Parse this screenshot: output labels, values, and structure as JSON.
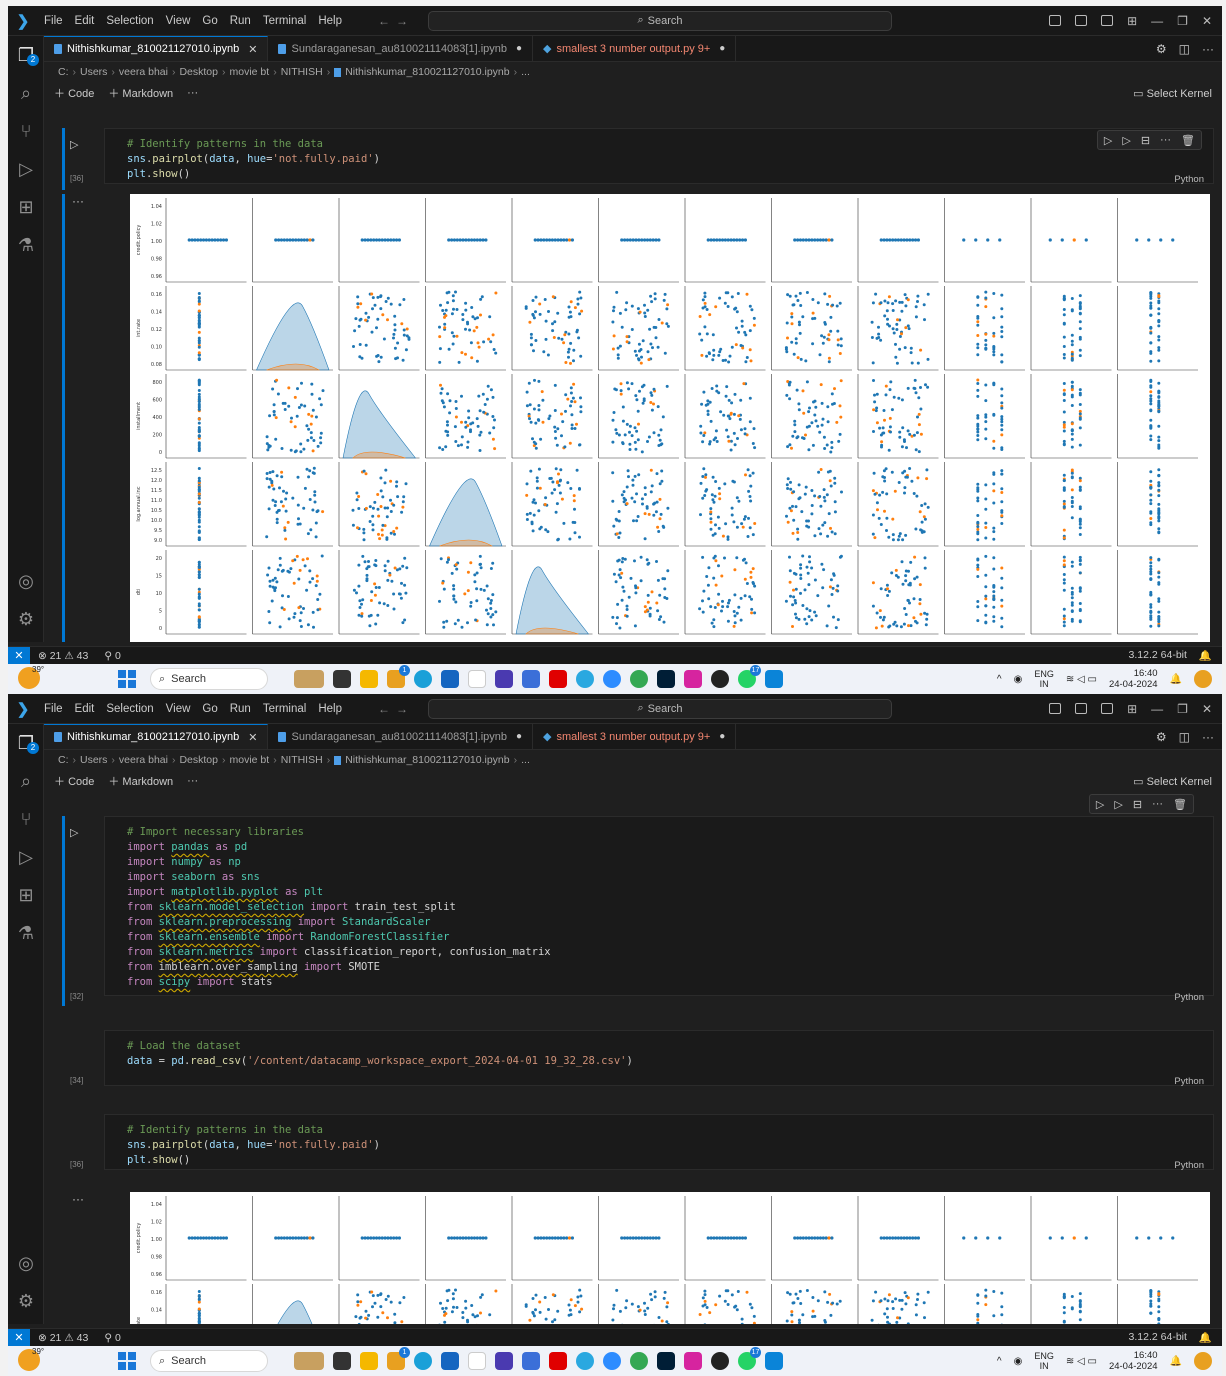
{
  "window": {
    "menu": [
      "File",
      "Edit",
      "Selection",
      "View",
      "Go",
      "Run",
      "Terminal",
      "Help"
    ],
    "search_label": "Search"
  },
  "activity": {
    "explorer_badge": "2"
  },
  "tabs": [
    {
      "label": "Nithishkumar_810021127010.ipynb",
      "state": "active"
    },
    {
      "label": "Sundaraganesan_au810021114083[1].ipynb",
      "state": "modified"
    },
    {
      "label": "smallest 3 number output.py 9+",
      "state": "warning"
    }
  ],
  "breadcrumb": [
    "C:",
    "Users",
    "veera bhai",
    "Desktop",
    "movie bt",
    "NITHISH",
    "Nithishkumar_810021127010.ipynb",
    "..."
  ],
  "toolbar": {
    "code": "Code",
    "markdown": "Markdown",
    "more": "···",
    "kernel": "Select Kernel"
  },
  "cell_language": "Python",
  "cells": {
    "imports": {
      "number": "[32]",
      "lines": [
        "# Import necessary libraries",
        "import pandas as pd",
        "import numpy as np",
        "import seaborn as sns",
        "import matplotlib.pyplot as plt",
        "from sklearn.model_selection import train_test_split",
        "from sklearn.preprocessing import StandardScaler",
        "from sklearn.ensemble import RandomForestClassifier",
        "from sklearn.metrics import classification_report, confusion_matrix",
        "from imblearn.over_sampling import SMOTE",
        "from scipy import stats"
      ]
    },
    "load": {
      "number": "[34]",
      "lines": [
        "# Load the dataset",
        "data = pd.read_csv('/content/datacamp_workspace_export_2024-04-01 19_32_28.csv')"
      ]
    },
    "pairplot": {
      "number": "[36]",
      "lines": [
        "# Identify patterns in the data",
        "sns.pairplot(data, hue='not.fully.paid')",
        "plt.show()"
      ]
    }
  },
  "output_ellipsis": "···",
  "chart_data": {
    "type": "scatter",
    "kind": "pairplot",
    "hue_colors": [
      "#1f77b4",
      "#ff7f0e"
    ],
    "columns": 12,
    "rows": [
      {
        "ylabel": "credit.policy",
        "ticks": [
          "1.04",
          "1.02",
          "1.00",
          "0.98",
          "0.96"
        ],
        "ylim": [
          0.96,
          1.04
        ]
      },
      {
        "ylabel": "int.rate",
        "ticks": [
          "0.16",
          "0.14",
          "0.12",
          "0.10",
          "0.08"
        ],
        "ylim": [
          0.07,
          0.165
        ]
      },
      {
        "ylabel": "installment",
        "ticks": [
          "800",
          "600",
          "400",
          "200",
          "0"
        ],
        "ylim": [
          0,
          850
        ]
      },
      {
        "ylabel": "log.annual.inc",
        "ticks": [
          "12.5",
          "12.0",
          "11.5",
          "11.0",
          "10.5",
          "10.0",
          "9.5",
          "9.0"
        ],
        "ylim": [
          9.0,
          12.6
        ]
      },
      {
        "ylabel": "dti",
        "ticks": [
          "20",
          "15",
          "10",
          "5",
          "0"
        ],
        "ylim": [
          -1,
          23
        ]
      }
    ],
    "diagonal_kde_row": [
      1,
      2,
      3,
      4
    ]
  },
  "status": {
    "errors": "21",
    "warnings": "43",
    "ports": "0",
    "python_version": "3.12.2 64-bit"
  },
  "taskbar": {
    "temperature": "39°",
    "search": "Search",
    "notif_badge_1": "1",
    "notif_badge_2": "17",
    "lang_top": "ENG",
    "lang_bottom": "IN",
    "time": "16:40",
    "date": "24-04-2024"
  },
  "colors": {
    "accent": "#0078d4",
    "editor_bg": "#1f1f1f",
    "comment": "#6a9955",
    "keyword": "#c586c0",
    "module": "#4ec9b0"
  }
}
